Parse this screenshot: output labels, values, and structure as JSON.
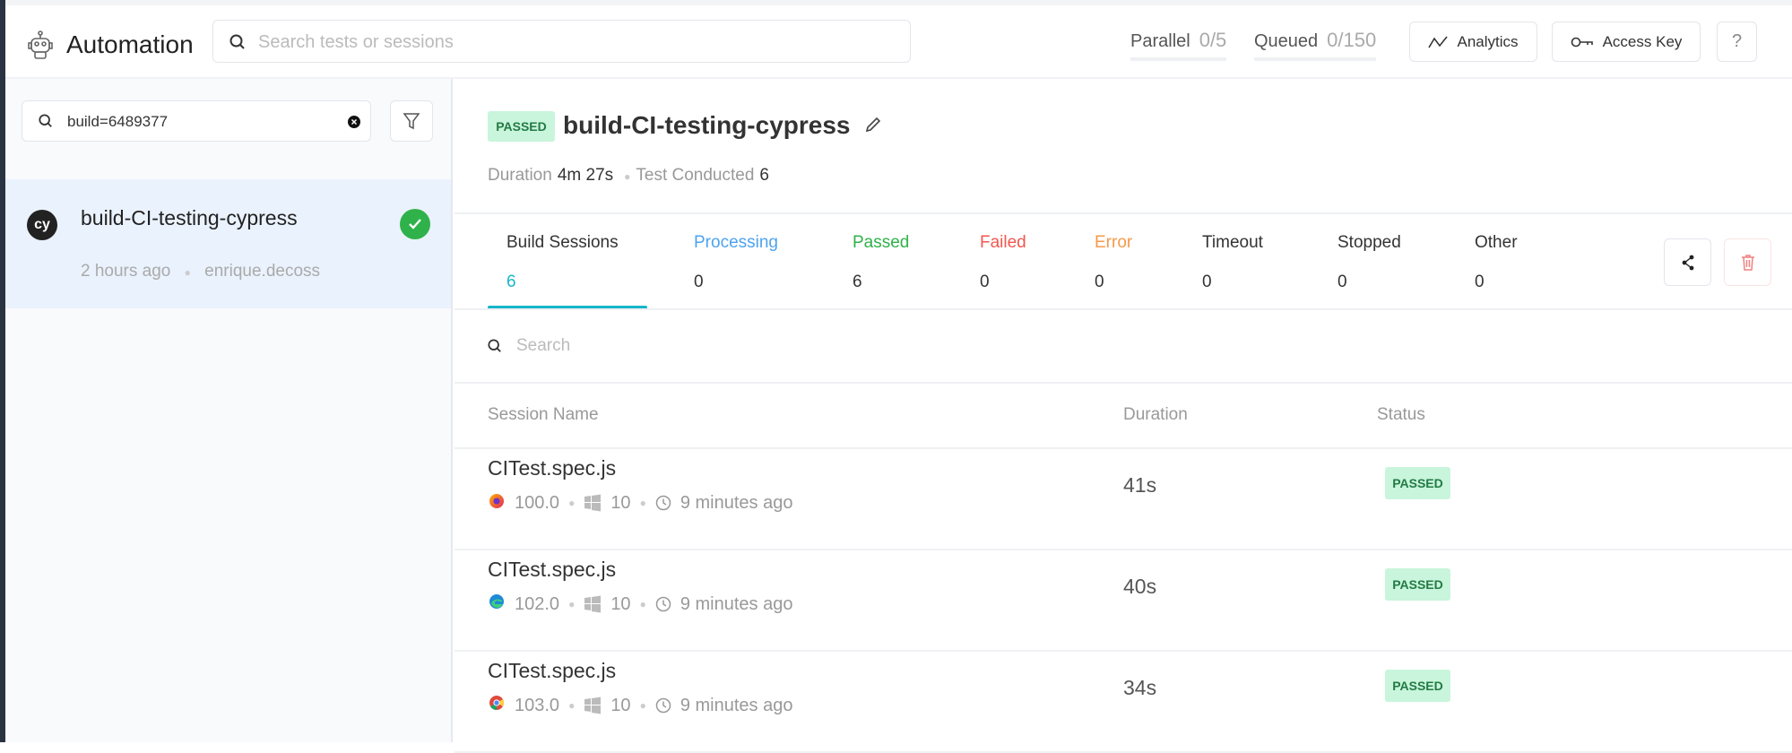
{
  "header": {
    "app_title": "Automation",
    "search_placeholder": "Search tests or sessions",
    "parallel_label": "Parallel",
    "parallel_value": "0/5",
    "queued_label": "Queued",
    "queued_value": "0/150",
    "analytics_label": "Analytics",
    "access_key_label": "Access Key",
    "help_label": "?"
  },
  "sidebar": {
    "search_value": "build=6489377",
    "builds": [
      {
        "avatar": "cy",
        "name": "build-CI-testing-cypress",
        "time": "2 hours ago",
        "user": "enrique.decoss",
        "status": "passed"
      }
    ]
  },
  "build": {
    "status": "PASSED",
    "name": "build-CI-testing-cypress",
    "duration_label": "Duration",
    "duration": "4m 27s",
    "tests_label": "Test Conducted",
    "tests": "6"
  },
  "tabs": [
    {
      "label": "Build Sessions",
      "count": "6",
      "color": "#333333"
    },
    {
      "label": "Processing",
      "count": "0",
      "color": "#4da3f0"
    },
    {
      "label": "Passed",
      "count": "6",
      "color": "#2fb24a"
    },
    {
      "label": "Failed",
      "count": "0",
      "color": "#f0584f"
    },
    {
      "label": "Error",
      "count": "0",
      "color": "#f59a4a"
    },
    {
      "label": "Timeout",
      "count": "0",
      "color": "#333333"
    },
    {
      "label": "Stopped",
      "count": "0",
      "color": "#333333"
    },
    {
      "label": "Other",
      "count": "0",
      "color": "#333333"
    }
  ],
  "sessions": {
    "search_placeholder": "Search",
    "columns": [
      "Session Name",
      "Duration",
      "Status"
    ],
    "rows": [
      {
        "name": "CITest.spec.js",
        "browser": "firefox",
        "browser_version": "100.0",
        "os": "windows",
        "os_version": "10",
        "time": "9 minutes ago",
        "duration": "41s",
        "status": "PASSED"
      },
      {
        "name": "CITest.spec.js",
        "browser": "edge",
        "browser_version": "102.0",
        "os": "windows",
        "os_version": "10",
        "time": "9 minutes ago",
        "duration": "40s",
        "status": "PASSED"
      },
      {
        "name": "CITest.spec.js",
        "browser": "chrome",
        "browser_version": "103.0",
        "os": "windows",
        "os_version": "10",
        "time": "9 minutes ago",
        "duration": "34s",
        "status": "PASSED"
      }
    ]
  }
}
